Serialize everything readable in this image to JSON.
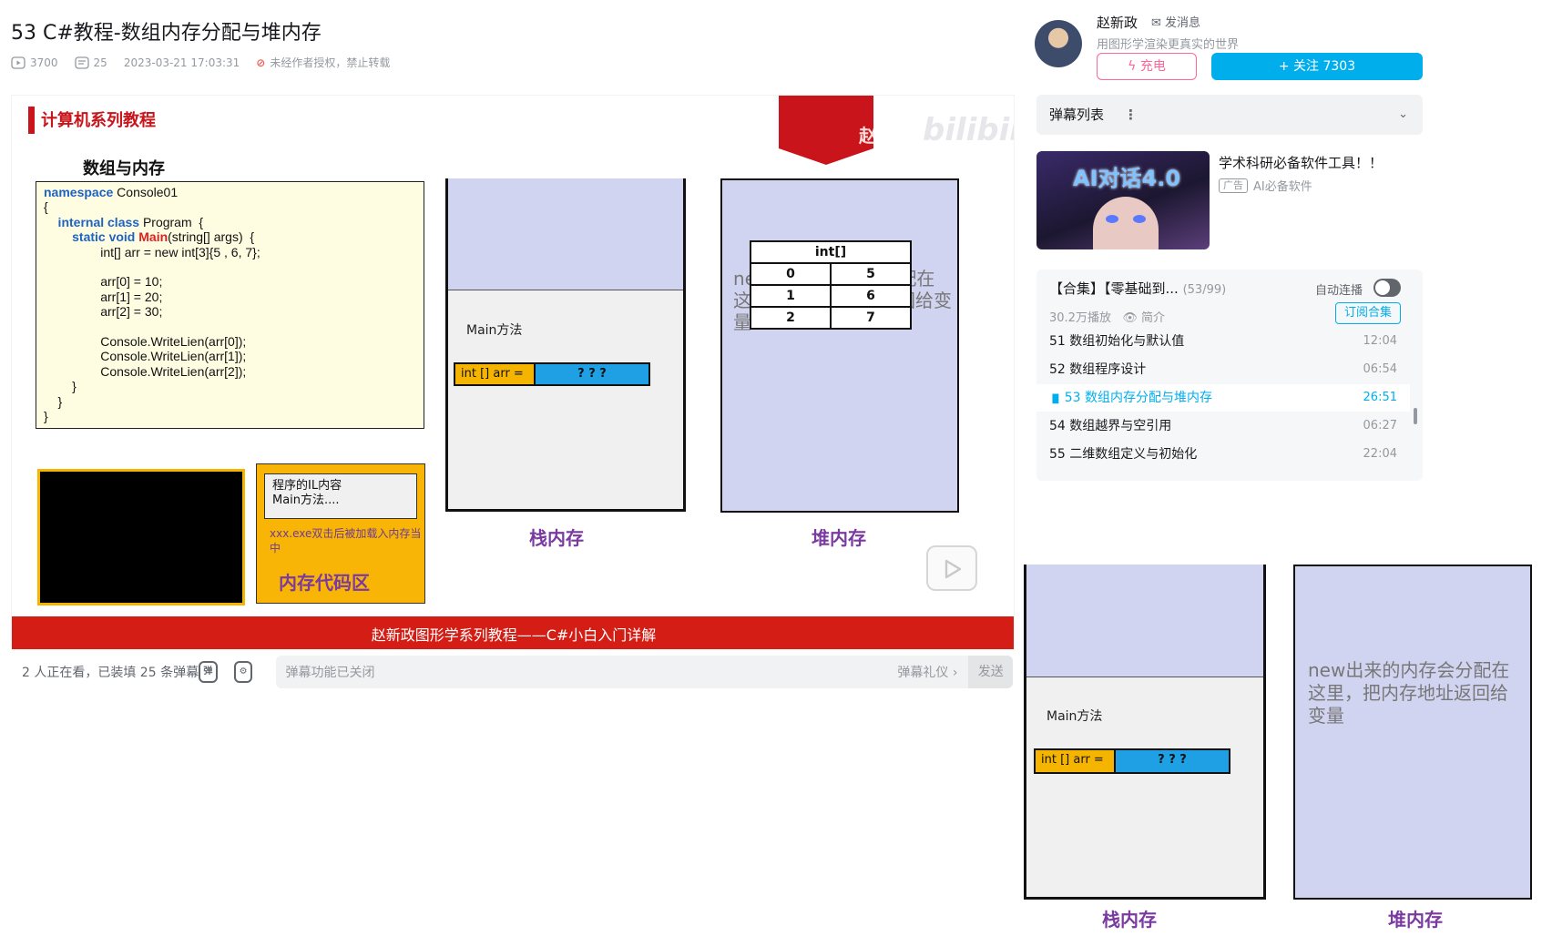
{
  "video": {
    "title": "53 C#教程-数组内存分配与堆内存",
    "views": "3700",
    "danmaku_count": "25",
    "published": "2023-03-21 17:03:31",
    "copyright_notice": "未经作者授权，禁止转载"
  },
  "slide": {
    "series_title": "计算机系列教程",
    "watermark_name": "赵",
    "watermark_logo": "bilibili",
    "section_heading": "数组与内存",
    "code_lines": [
      {
        "kw": "namespace",
        "rest": " Console01"
      },
      {
        "kw": "",
        "rest": "{"
      },
      {
        "kw": "    internal class",
        "rest": " Program  {"
      },
      {
        "kw": "        static void",
        "kw2": " Main",
        "rest": "(string[] args)  {"
      },
      {
        "kw": "",
        "rest": "                int[] arr = new int[3]{5 , 6, 7};"
      },
      {
        "kw": "",
        "rest": ""
      },
      {
        "kw": "",
        "rest": "                arr[0] = 10;"
      },
      {
        "kw": "",
        "rest": "                arr[1] = 20;"
      },
      {
        "kw": "",
        "rest": "                arr[2] = 30;"
      },
      {
        "kw": "",
        "rest": ""
      },
      {
        "kw": "",
        "rest": "                Console.WriteLien(arr[0]);"
      },
      {
        "kw": "",
        "rest": "                Console.WriteLien(arr[1]);"
      },
      {
        "kw": "",
        "rest": "                Console.WriteLien(arr[2]);"
      },
      {
        "kw": "",
        "rest": "        }"
      },
      {
        "kw": "",
        "rest": "    }"
      },
      {
        "kw": "",
        "rest": "}"
      }
    ],
    "il_box_text": "程序的IL内容\nMain方法....",
    "il_desc": "xxx.exe双击后被加载入内存当中",
    "il_area_name": "内存代码区",
    "stack_method": "Main方法",
    "var_name": "int [] arr =",
    "var_value": "? ? ?",
    "stack_caption": "栈内存",
    "heap_text": "new出来的内存会分配在这里，把内存地址返回给变量",
    "array_table": {
      "header": "int[]",
      "rows": [
        [
          "0",
          "5"
        ],
        [
          "1",
          "6"
        ],
        [
          "2",
          "7"
        ]
      ]
    },
    "heap_caption": "堆内存",
    "banner": "赵新政图形学系列教程——C#小白入门详解",
    "progress_fraction": 0.18
  },
  "danmaku_bar": {
    "watching": "2 人正在看，已装填 25 条弹幕",
    "input_placeholder": "弹幕功能已关闭",
    "etiquette": "弹幕礼仪 ›",
    "send": "发送"
  },
  "uploader": {
    "name": "赵新政",
    "message_link": "发消息",
    "signature": "用图形学渲染更真实的世界",
    "charge": "充电",
    "follow": "+ 关注 7303"
  },
  "danmaku_list": {
    "title": "弹幕列表",
    "more": "⋮",
    "expand": "⌄"
  },
  "ad": {
    "image_text": "AI对话4.0",
    "title": "学术科研必备软件工具！！",
    "badge": "广告",
    "source": "AI必备软件"
  },
  "collection": {
    "title": "【合集】【零基础到...",
    "count": "(53/99)",
    "autoplay": "自动连播",
    "plays": "30.2万播放",
    "intro": "简介",
    "subscribe": "订阅合集",
    "episodes": [
      {
        "label": "51 数组初始化与默认值",
        "duration": "12:04",
        "active": false
      },
      {
        "label": "52 数组程序设计",
        "duration": "06:54",
        "active": false
      },
      {
        "label": "53 数组内存分配与堆内存",
        "duration": "26:51",
        "active": true
      },
      {
        "label": "54 数组越界与空引用",
        "duration": "06:27",
        "active": false
      },
      {
        "label": "55 二维数组定义与初始化",
        "duration": "22:04",
        "active": false
      }
    ]
  },
  "detail": {
    "stack_method": "Main方法",
    "var_name": "int [] arr =",
    "var_value": "? ? ?",
    "heap_text": "new出来的内存会分配在这里，把内存地址返回给变量",
    "stack_caption": "栈内存",
    "heap_caption": "堆内存"
  },
  "colors": {
    "accent": "#00aeec",
    "slide_red": "#c8141a",
    "caption_purple": "#7a3aa0",
    "heap_fill": "#d0d4f0",
    "stack_var": "#f5b400",
    "stack_value": "#1fa0e4"
  }
}
